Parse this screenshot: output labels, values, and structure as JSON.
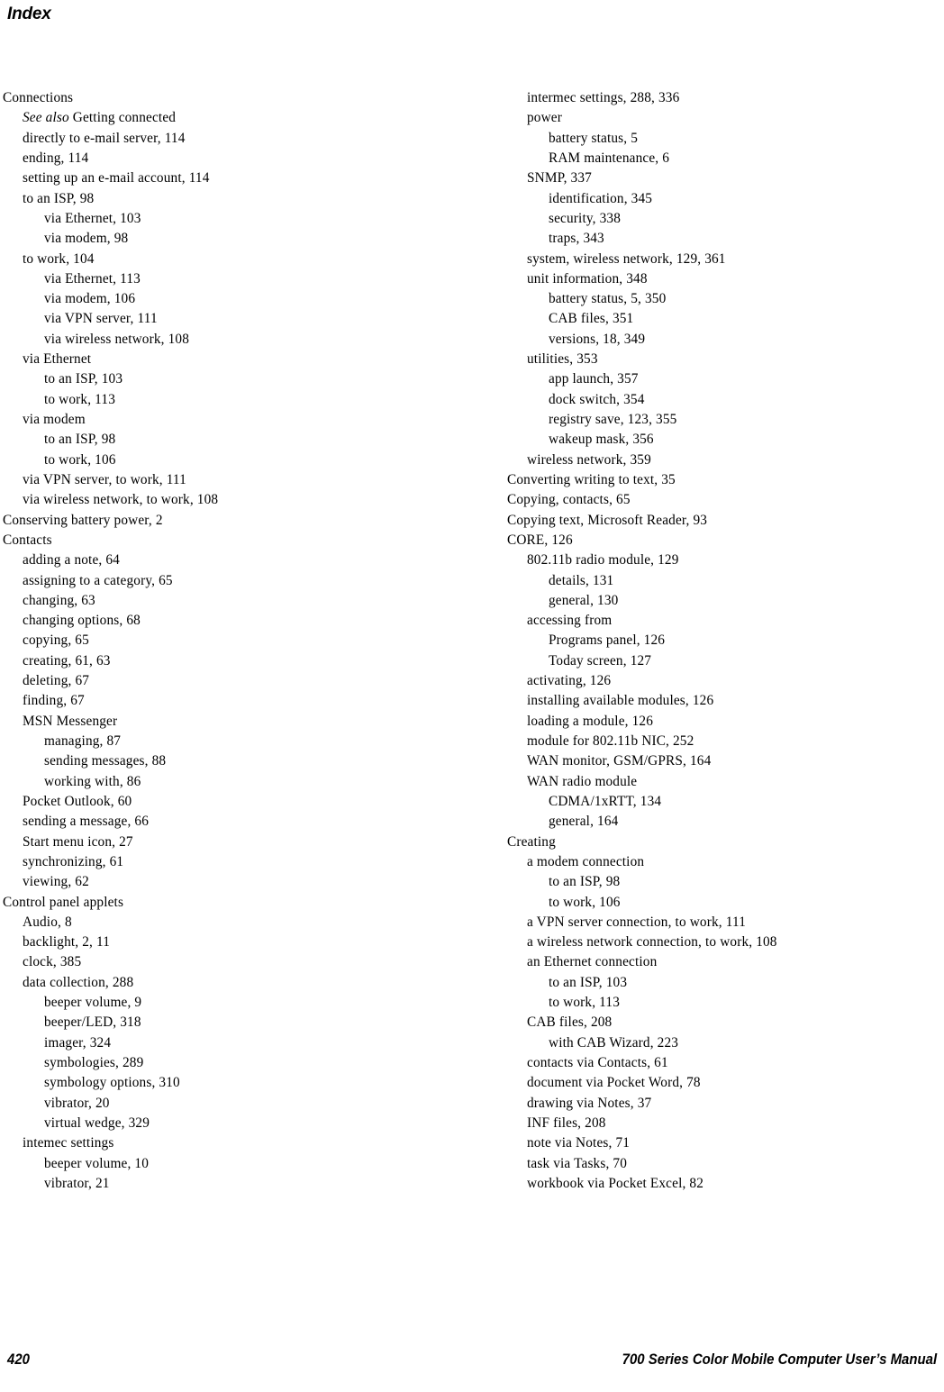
{
  "header": {
    "title": "Index"
  },
  "footer": {
    "page_number": "420",
    "manual_title": "700 Series Color Mobile Computer User’s Manual"
  },
  "index": {
    "left_column": [
      {
        "level": 0,
        "text": "Connections"
      },
      {
        "level": 1,
        "text": "See also Getting connected",
        "italic_prefix": "See also"
      },
      {
        "level": 1,
        "text": "directly to e-mail server, 114"
      },
      {
        "level": 1,
        "text": "ending, 114"
      },
      {
        "level": 1,
        "text": "setting up an e-mail account, 114"
      },
      {
        "level": 1,
        "text": "to an ISP, 98"
      },
      {
        "level": 2,
        "text": "via Ethernet, 103"
      },
      {
        "level": 2,
        "text": "via modem, 98"
      },
      {
        "level": 1,
        "text": "to work, 104"
      },
      {
        "level": 2,
        "text": "via Ethernet, 113"
      },
      {
        "level": 2,
        "text": "via modem, 106"
      },
      {
        "level": 2,
        "text": "via VPN server, 111"
      },
      {
        "level": 2,
        "text": "via wireless network, 108"
      },
      {
        "level": 1,
        "text": "via Ethernet"
      },
      {
        "level": 2,
        "text": "to an ISP, 103"
      },
      {
        "level": 2,
        "text": "to work, 113"
      },
      {
        "level": 1,
        "text": "via modem"
      },
      {
        "level": 2,
        "text": "to an ISP, 98"
      },
      {
        "level": 2,
        "text": "to work, 106"
      },
      {
        "level": 1,
        "text": "via VPN server, to work, 111"
      },
      {
        "level": 1,
        "text": "via wireless network, to work, 108"
      },
      {
        "level": 0,
        "text": "Conserving battery power, 2"
      },
      {
        "level": 0,
        "text": "Contacts"
      },
      {
        "level": 1,
        "text": "adding a note, 64"
      },
      {
        "level": 1,
        "text": "assigning to a category, 65"
      },
      {
        "level": 1,
        "text": "changing, 63"
      },
      {
        "level": 1,
        "text": "changing options, 68"
      },
      {
        "level": 1,
        "text": "copying, 65"
      },
      {
        "level": 1,
        "text": "creating, 61, 63"
      },
      {
        "level": 1,
        "text": "deleting, 67"
      },
      {
        "level": 1,
        "text": "finding, 67"
      },
      {
        "level": 1,
        "text": "MSN Messenger"
      },
      {
        "level": 2,
        "text": "managing, 87"
      },
      {
        "level": 2,
        "text": "sending messages, 88"
      },
      {
        "level": 2,
        "text": "working with, 86"
      },
      {
        "level": 1,
        "text": "Pocket Outlook, 60"
      },
      {
        "level": 1,
        "text": "sending a message, 66"
      },
      {
        "level": 1,
        "text": "Start menu icon, 27"
      },
      {
        "level": 1,
        "text": "synchronizing, 61"
      },
      {
        "level": 1,
        "text": "viewing, 62"
      },
      {
        "level": 0,
        "text": "Control panel applets"
      },
      {
        "level": 1,
        "text": "Audio, 8"
      },
      {
        "level": 1,
        "text": "backlight, 2, 11"
      },
      {
        "level": 1,
        "text": "clock, 385"
      },
      {
        "level": 1,
        "text": "data collection, 288"
      },
      {
        "level": 2,
        "text": "beeper volume, 9"
      },
      {
        "level": 2,
        "text": "beeper/LED, 318"
      },
      {
        "level": 2,
        "text": "imager, 324"
      },
      {
        "level": 2,
        "text": "symbologies, 289"
      },
      {
        "level": 2,
        "text": "symbology options, 310"
      },
      {
        "level": 2,
        "text": "vibrator, 20"
      },
      {
        "level": 2,
        "text": "virtual wedge, 329"
      },
      {
        "level": 1,
        "text": "intemec settings"
      },
      {
        "level": 2,
        "text": "beeper volume, 10"
      },
      {
        "level": 2,
        "text": "vibrator, 21"
      }
    ],
    "right_column": [
      {
        "level": 1,
        "text": "intermec settings, 288, 336"
      },
      {
        "level": 1,
        "text": "power"
      },
      {
        "level": 2,
        "text": "battery status, 5"
      },
      {
        "level": 2,
        "text": "RAM maintenance, 6"
      },
      {
        "level": 1,
        "text": "SNMP, 337"
      },
      {
        "level": 2,
        "text": "identification, 345"
      },
      {
        "level": 2,
        "text": "security, 338"
      },
      {
        "level": 2,
        "text": "traps, 343"
      },
      {
        "level": 1,
        "text": "system, wireless network, 129, 361"
      },
      {
        "level": 1,
        "text": "unit information, 348"
      },
      {
        "level": 2,
        "text": "battery status, 5, 350"
      },
      {
        "level": 2,
        "text": "CAB files, 351"
      },
      {
        "level": 2,
        "text": "versions, 18, 349"
      },
      {
        "level": 1,
        "text": "utilities, 353"
      },
      {
        "level": 2,
        "text": "app launch, 357"
      },
      {
        "level": 2,
        "text": "dock switch, 354"
      },
      {
        "level": 2,
        "text": "registry save, 123, 355"
      },
      {
        "level": 2,
        "text": "wakeup mask, 356"
      },
      {
        "level": 1,
        "text": "wireless network, 359"
      },
      {
        "level": 0,
        "text": "Converting writing to text, 35"
      },
      {
        "level": 0,
        "text": "Copying, contacts, 65"
      },
      {
        "level": 0,
        "text": "Copying text, Microsoft Reader, 93"
      },
      {
        "level": 0,
        "text": "CORE, 126"
      },
      {
        "level": 1,
        "text": "802.11b radio module, 129"
      },
      {
        "level": 2,
        "text": "details, 131"
      },
      {
        "level": 2,
        "text": "general, 130"
      },
      {
        "level": 1,
        "text": "accessing from"
      },
      {
        "level": 2,
        "text": "Programs panel, 126"
      },
      {
        "level": 2,
        "text": "Today screen, 127"
      },
      {
        "level": 1,
        "text": "activating, 126"
      },
      {
        "level": 1,
        "text": "installing available modules, 126"
      },
      {
        "level": 1,
        "text": "loading a module, 126"
      },
      {
        "level": 1,
        "text": "module for 802.11b NIC, 252"
      },
      {
        "level": 1,
        "text": "WAN monitor, GSM/GPRS, 164"
      },
      {
        "level": 1,
        "text": "WAN radio module"
      },
      {
        "level": 2,
        "text": "CDMA/1xRTT, 134"
      },
      {
        "level": 2,
        "text": "general, 164"
      },
      {
        "level": 0,
        "text": "Creating"
      },
      {
        "level": 1,
        "text": "a modem connection"
      },
      {
        "level": 2,
        "text": "to an ISP, 98"
      },
      {
        "level": 2,
        "text": "to work, 106"
      },
      {
        "level": 1,
        "text": "a VPN server connection, to work, 111"
      },
      {
        "level": 1,
        "text": "a wireless network connection, to work, 108"
      },
      {
        "level": 1,
        "text": "an Ethernet connection"
      },
      {
        "level": 2,
        "text": "to an ISP, 103"
      },
      {
        "level": 2,
        "text": "to work, 113"
      },
      {
        "level": 1,
        "text": "CAB files, 208"
      },
      {
        "level": 2,
        "text": "with CAB Wizard, 223"
      },
      {
        "level": 1,
        "text": "contacts via Contacts, 61"
      },
      {
        "level": 1,
        "text": "document via Pocket Word, 78"
      },
      {
        "level": 1,
        "text": "drawing via Notes, 37"
      },
      {
        "level": 1,
        "text": "INF files, 208"
      },
      {
        "level": 1,
        "text": "note via Notes, 71"
      },
      {
        "level": 1,
        "text": "task via Tasks, 70"
      },
      {
        "level": 1,
        "text": "workbook via Pocket Excel, 82"
      }
    ]
  }
}
